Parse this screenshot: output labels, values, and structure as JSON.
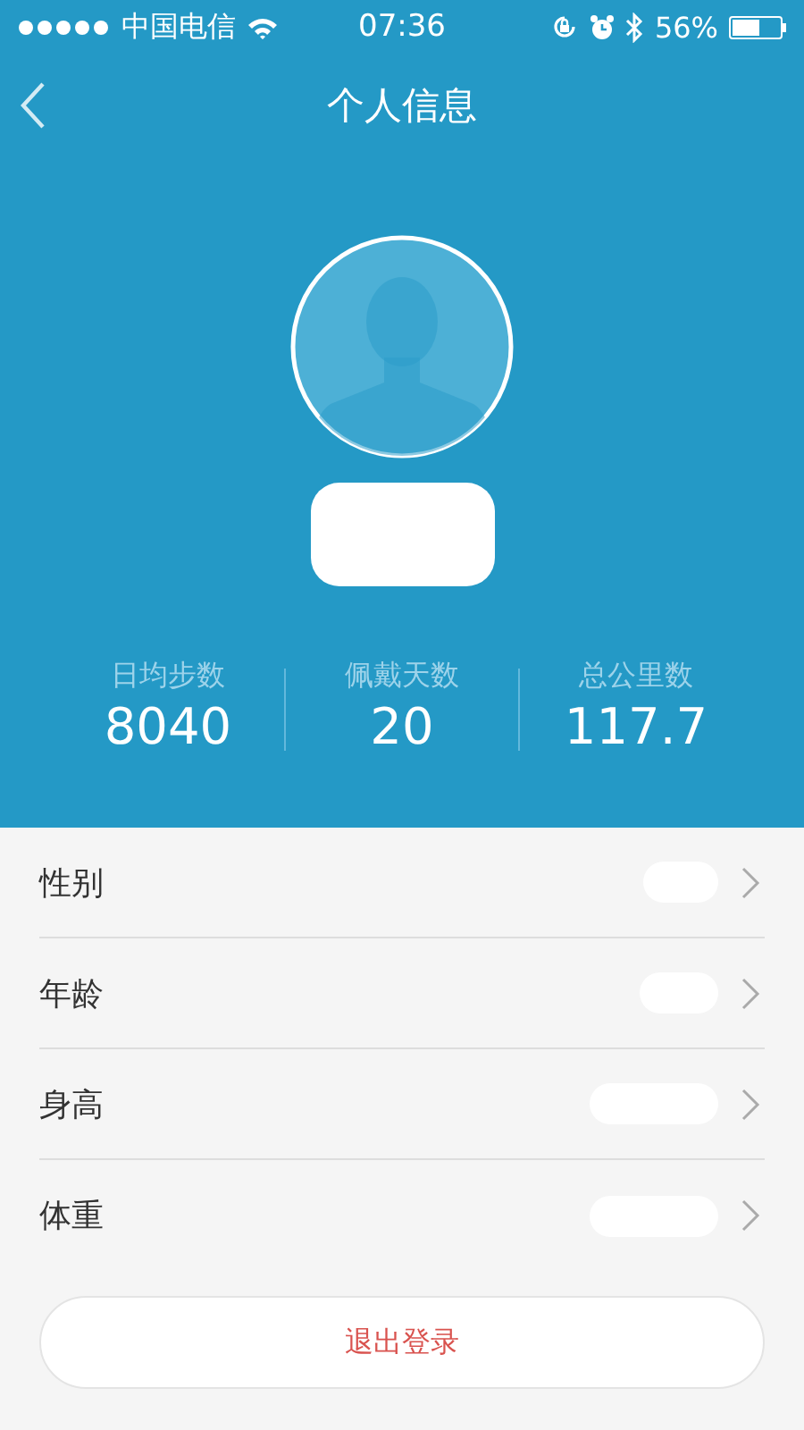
{
  "status_bar": {
    "carrier": "中国电信",
    "time": "07:36",
    "battery": "56%"
  },
  "nav": {
    "title": "个人信息"
  },
  "stats": [
    {
      "label": "日均步数",
      "value": "8040"
    },
    {
      "label": "佩戴天数",
      "value": "20"
    },
    {
      "label": "总公里数",
      "value": "117.7"
    }
  ],
  "fields": [
    {
      "label": "性别"
    },
    {
      "label": "年龄"
    },
    {
      "label": "身高"
    },
    {
      "label": "体重"
    }
  ],
  "logout_button": "退出登录"
}
